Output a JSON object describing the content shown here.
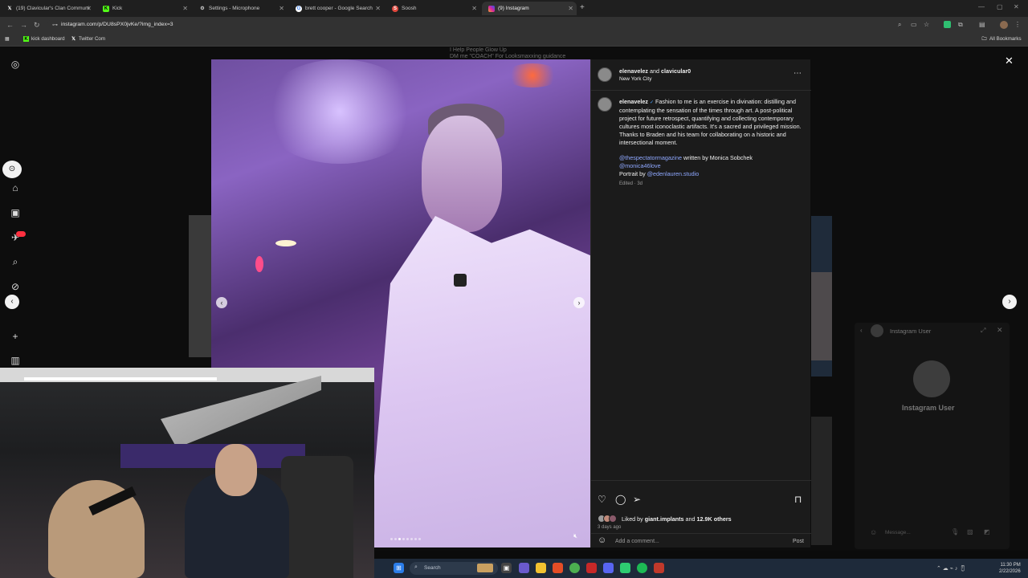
{
  "browser": {
    "tabs": [
      {
        "label": "(19) Clavicular's Clan Communi",
        "favicon": "X"
      },
      {
        "label": "Kick",
        "favicon": "K"
      },
      {
        "label": "Settings - Microphone",
        "favicon": "gear"
      },
      {
        "label": "brett cooper - Google Search",
        "favicon": "G"
      },
      {
        "label": "Soosh",
        "favicon": "S"
      },
      {
        "label": "(9) Instagram",
        "favicon": "IG"
      }
    ],
    "url": "instagram.com/p/DU8sPX0jvKe/?img_index=3",
    "bookmarks": [
      {
        "label": "kick dashboard"
      },
      {
        "label": "Twitter Com"
      }
    ],
    "all_bookmarks": "All Bookmarks"
  },
  "background_text": {
    "line1": "I Help People Glow Up",
    "line2": "DM me \"COACH\" For Looksmaxxing guidance"
  },
  "post": {
    "header_user": "elenavelez",
    "header_and": "and",
    "header_collab": "clavicular0",
    "location": "New York City",
    "caption_user": "elenavelez",
    "caption": "Fashion to me is an exercise in divination: distilling and contemplating the sensation of the times through art. A post-political project for future retrospect, quantifying and collecting contemporary cultures most iconoclastic artifacts. It's a sacred and privileged mission. Thanks to Braden and his team for collaborating on a historic and intersectional moment.",
    "mention1": "@thespectatormagazine",
    "written_by": "written by Monica Sobchek",
    "mention2": "@monica46love",
    "portrait_by": "Portrait by",
    "mention3": "@edenlauren.studio",
    "edited": "Edited · 3d",
    "liked_by_prefix": "Liked by",
    "liked_by_user": "giant.implants",
    "liked_by_and": "and",
    "liked_by_others": "12.9K others",
    "time_ago": "3 days ago",
    "comment_placeholder": "Add a comment...",
    "post_button": "Post",
    "carousel_index": 3,
    "carousel_total": 8
  },
  "chat": {
    "title": "Instagram User",
    "name": "Instagram User",
    "message_placeholder": "Message..."
  },
  "taskbar": {
    "search": "Search",
    "time": "11:30 PM",
    "date": "2/22/2026"
  },
  "colors": {
    "link": "#8fa8ff",
    "panel_bg": "#1b1b1b"
  }
}
